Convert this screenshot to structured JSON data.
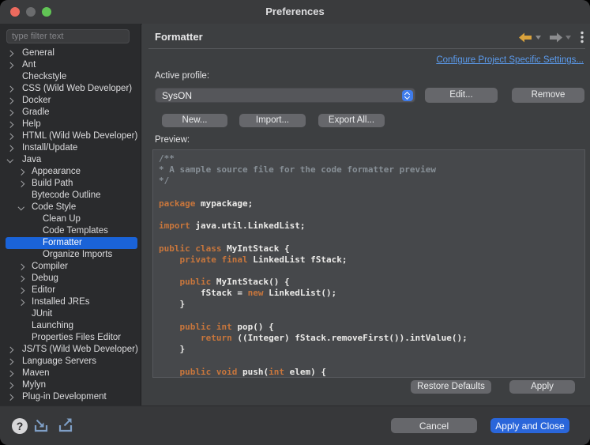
{
  "window": {
    "title": "Preferences",
    "controls": [
      "close",
      "minimize-disabled",
      "zoom"
    ]
  },
  "sidebar": {
    "filter_placeholder": "type filter text",
    "items": [
      {
        "label": "General",
        "indent": 0,
        "chevron": "right"
      },
      {
        "label": "Ant",
        "indent": 0,
        "chevron": "right"
      },
      {
        "label": "Checkstyle",
        "indent": 0,
        "chevron": "none"
      },
      {
        "label": "CSS (Wild Web Developer)",
        "indent": 0,
        "chevron": "right"
      },
      {
        "label": "Docker",
        "indent": 0,
        "chevron": "right"
      },
      {
        "label": "Gradle",
        "indent": 0,
        "chevron": "right"
      },
      {
        "label": "Help",
        "indent": 0,
        "chevron": "right"
      },
      {
        "label": "HTML (Wild Web Developer)",
        "indent": 0,
        "chevron": "right"
      },
      {
        "label": "Install/Update",
        "indent": 0,
        "chevron": "right"
      },
      {
        "label": "Java",
        "indent": 0,
        "chevron": "down"
      },
      {
        "label": "Appearance",
        "indent": 1,
        "chevron": "right"
      },
      {
        "label": "Build Path",
        "indent": 1,
        "chevron": "right"
      },
      {
        "label": "Bytecode Outline",
        "indent": 1,
        "chevron": "none"
      },
      {
        "label": "Code Style",
        "indent": 1,
        "chevron": "down"
      },
      {
        "label": "Clean Up",
        "indent": 2,
        "chevron": "none"
      },
      {
        "label": "Code Templates",
        "indent": 2,
        "chevron": "none"
      },
      {
        "label": "Formatter",
        "indent": 2,
        "chevron": "none",
        "selected": true
      },
      {
        "label": "Organize Imports",
        "indent": 2,
        "chevron": "none"
      },
      {
        "label": "Compiler",
        "indent": 1,
        "chevron": "right"
      },
      {
        "label": "Debug",
        "indent": 1,
        "chevron": "right"
      },
      {
        "label": "Editor",
        "indent": 1,
        "chevron": "right"
      },
      {
        "label": "Installed JREs",
        "indent": 1,
        "chevron": "right"
      },
      {
        "label": "JUnit",
        "indent": 1,
        "chevron": "none"
      },
      {
        "label": "Launching",
        "indent": 1,
        "chevron": "none"
      },
      {
        "label": "Properties Files Editor",
        "indent": 1,
        "chevron": "none"
      },
      {
        "label": "JS/TS (Wild Web Developer)",
        "indent": 0,
        "chevron": "right"
      },
      {
        "label": "Language Servers",
        "indent": 0,
        "chevron": "right"
      },
      {
        "label": "Maven",
        "indent": 0,
        "chevron": "right"
      },
      {
        "label": "Mylyn",
        "indent": 0,
        "chevron": "right"
      },
      {
        "label": "Plug-in Development",
        "indent": 0,
        "chevron": "right"
      }
    ]
  },
  "header": {
    "title": "Formatter",
    "icons": [
      "back-arrow",
      "forward-arrow",
      "view-menu-ellipsis"
    ]
  },
  "content": {
    "configure_link": "Configure Project Specific Settings...",
    "active_profile_label": "Active profile:",
    "profile_select": {
      "value": "SysON",
      "stepper_icon": "up-down-chevrons"
    },
    "buttons": {
      "edit": "Edit...",
      "remove": "Remove",
      "new": "New...",
      "import": "Import...",
      "export_all": "Export All...",
      "restore_defaults": "Restore Defaults",
      "apply": "Apply"
    },
    "preview_label": "Preview:",
    "code_lines": [
      [
        [
          "c",
          "/**"
        ]
      ],
      [
        [
          "c",
          "* A sample source file for the code formatter preview"
        ]
      ],
      [
        [
          "c",
          "*/"
        ]
      ],
      [],
      [
        [
          "k",
          "package"
        ],
        [
          "p",
          " mypackage;"
        ]
      ],
      [],
      [
        [
          "k",
          "import"
        ],
        [
          "p",
          " java.util.LinkedList;"
        ]
      ],
      [],
      [
        [
          "k",
          "public"
        ],
        [
          "p",
          " "
        ],
        [
          "k",
          "class"
        ],
        [
          "p",
          " MyIntStack {"
        ]
      ],
      [
        [
          "p",
          "    "
        ],
        [
          "k",
          "private"
        ],
        [
          "p",
          " "
        ],
        [
          "k",
          "final"
        ],
        [
          "p",
          " LinkedList fStack;"
        ]
      ],
      [],
      [
        [
          "p",
          "    "
        ],
        [
          "k",
          "public"
        ],
        [
          "p",
          " MyIntStack() {"
        ]
      ],
      [
        [
          "p",
          "        fStack = "
        ],
        [
          "k",
          "new"
        ],
        [
          "p",
          " LinkedList();"
        ]
      ],
      [
        [
          "p",
          "    }"
        ]
      ],
      [],
      [
        [
          "p",
          "    "
        ],
        [
          "k",
          "public"
        ],
        [
          "p",
          " "
        ],
        [
          "k",
          "int"
        ],
        [
          "p",
          " pop() {"
        ]
      ],
      [
        [
          "p",
          "        "
        ],
        [
          "k",
          "return"
        ],
        [
          "p",
          " ((Integer) fStack.removeFirst()).intValue();"
        ]
      ],
      [
        [
          "p",
          "    }"
        ]
      ],
      [],
      [
        [
          "p",
          "    "
        ],
        [
          "k",
          "public"
        ],
        [
          "p",
          " "
        ],
        [
          "k",
          "void"
        ],
        [
          "p",
          " push("
        ],
        [
          "k",
          "int"
        ],
        [
          "p",
          " elem) {"
        ]
      ]
    ]
  },
  "footer": {
    "cancel": "Cancel",
    "apply_and_close": "Apply and Close",
    "icons": [
      "help-question-circle",
      "import-preferences",
      "export-preferences"
    ]
  },
  "colors": {
    "selection_blue": "#1a63d8",
    "accent_blue": "#2a66da",
    "link_blue": "#5b9bed",
    "keyword_orange": "#c8763c",
    "comment_gray": "#878f96",
    "back_arrow_gold": "#d9a23c"
  }
}
